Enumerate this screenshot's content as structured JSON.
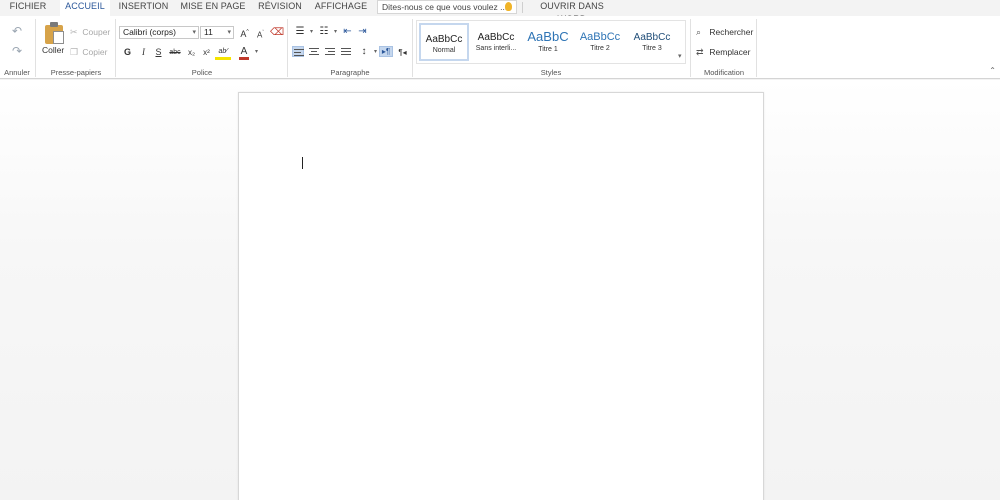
{
  "tabs": [
    {
      "label": "FICHIER"
    },
    {
      "label": "ACCUEIL",
      "active": true
    },
    {
      "label": "INSERTION"
    },
    {
      "label": "MISE EN PAGE"
    },
    {
      "label": "RÉVISION"
    },
    {
      "label": "AFFICHAGE"
    }
  ],
  "tell_me": {
    "placeholder": "Dites-nous ce que vous voulez ..."
  },
  "open_in_word": "OUVRIR DANS WORD",
  "ribbon": {
    "undo_group_label": "Annuler",
    "clipboard": {
      "label": "Presse-papiers",
      "paste": "Coller",
      "cut": "Couper",
      "copy": "Copier"
    },
    "font": {
      "label": "Police",
      "family": "Calibri (corps)",
      "size": "11",
      "bold": "G",
      "italic": "I",
      "underline": "S",
      "strike": "abc",
      "subscript": "x₂",
      "superscript": "x²",
      "highlight": "ab⁄",
      "color": "A",
      "grow": "A",
      "shrink": "A"
    },
    "paragraph": {
      "label": "Paragraphe"
    },
    "styles": {
      "label": "Styles",
      "items": [
        {
          "sample": "AaBbCc",
          "name": "Normal"
        },
        {
          "sample": "AaBbCc",
          "name": "Sans interli..."
        },
        {
          "sample": "AaBbC",
          "name": "Titre 1"
        },
        {
          "sample": "AaBbCc",
          "name": "Titre 2"
        },
        {
          "sample": "AaBbCc",
          "name": "Titre 3"
        }
      ]
    },
    "editing": {
      "label": "Modification",
      "find": "Rechercher",
      "replace": "Remplacer"
    }
  },
  "colors": {
    "accent": "#2b579a",
    "heading": "#2e74b5",
    "highlight": "#f5e400",
    "font_color": "#c0392b"
  }
}
